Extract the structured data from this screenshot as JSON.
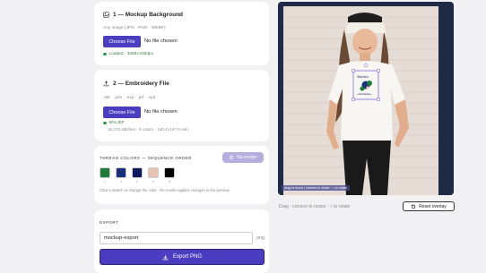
{
  "background_card": {
    "title": "1 — Mockup Background",
    "hint": "Any image (JPG · PNG · WEBP)",
    "choose_label": "Choose File",
    "no_file": "No file chosen",
    "status": "Loaded · 3368×4353px"
  },
  "embroidery_card": {
    "title": "2 — Embroidery File",
    "hint": ".dst · .pes · .exp · .jef · .vp3",
    "choose_label": "Choose File",
    "no_file": "No file chosen",
    "file_name": "6IN.JEF",
    "file_stats": "16,472 stitches · 5 colors · 140.4×147.6 mm"
  },
  "thread_colors": {
    "label": "THREAD COLORS — SEQUENCE ORDER",
    "rerender_label": "Re-render",
    "swatches": [
      {
        "number": "1",
        "color": "#1f7a3a"
      },
      {
        "number": "2",
        "color": "#1a2f7a"
      },
      {
        "number": "3",
        "color": "#0f1a5c"
      },
      {
        "number": "4",
        "color": "#e9c1b0"
      },
      {
        "number": "5",
        "color": "#050505"
      }
    ],
    "help": "Click a swatch to change the color · Re-render applies changes to the preview"
  },
  "export": {
    "label": "EXPORT",
    "filename": "mockup-export",
    "extension": ".png",
    "button_label": "Export PNG"
  },
  "preview": {
    "caption": "drag to move / corners to resize · ○ to rotate",
    "instructions": "Drag · corners to resize · ○ to rotate",
    "reset_label": "Reset overlay"
  },
  "colors": {
    "accent": "#4a3dbf",
    "success": "#2e9b4f",
    "preview_bg": "#1f2b46"
  }
}
